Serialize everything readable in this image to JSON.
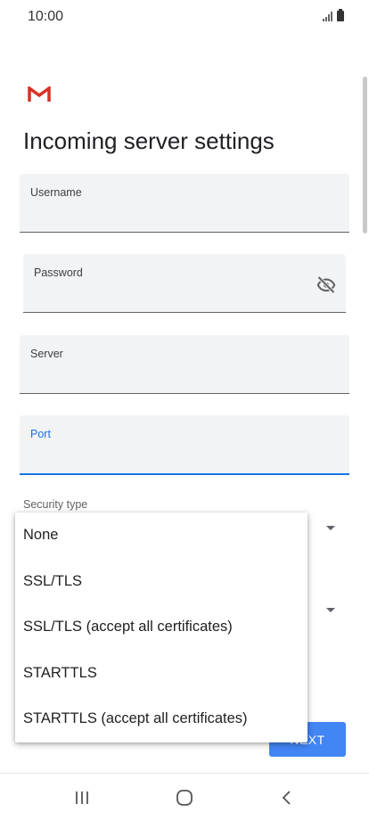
{
  "status_bar": {
    "time": "10:00",
    "icons": [
      "signal-icon",
      "battery-icon"
    ]
  },
  "app": {
    "logo": "gmail-logo",
    "title": "Incoming server settings"
  },
  "fields": {
    "username": {
      "label": "Username",
      "value": ""
    },
    "password": {
      "label": "Password",
      "value": "",
      "toggle_icon": "visibility-off-icon"
    },
    "server": {
      "label": "Server",
      "value": ""
    },
    "port": {
      "label": "Port",
      "value": "",
      "focused": true
    }
  },
  "security": {
    "label": "Security type",
    "options": [
      "None",
      "SSL/TLS",
      "SSL/TLS (accept all certificates)",
      "STARTTLS",
      "STARTTLS (accept all certificates)"
    ]
  },
  "buttons": {
    "next_label": "NEXT"
  },
  "colors": {
    "accent": "#1a73e8",
    "button": "#4285f4",
    "gmail_red": "#d93025",
    "field_bg": "#f1f3f4"
  },
  "nav_bar": {
    "recents_icon": "recents-icon",
    "home_icon": "home-icon",
    "back_icon": "back-icon"
  }
}
